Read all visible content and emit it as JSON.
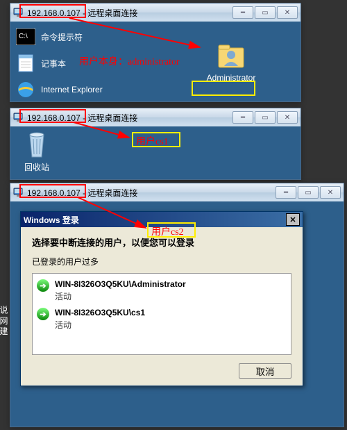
{
  "ip": "192.168.0.107",
  "title_suffix": " - 远程桌面连接",
  "window1": {
    "icons": {
      "cmd": "命令提示符",
      "notepad": "记事本",
      "ie": "Internet Explorer",
      "user": "Administrator"
    },
    "annotation": "用户本身：administrator"
  },
  "window2": {
    "icons": {
      "recycle": "回收站"
    },
    "annotation": "用户cs1"
  },
  "window3": {
    "annotation": "用户cs2",
    "dialog": {
      "title": "Windows 登录",
      "instruction": "选择要中断连接的用户，以便您可以登录",
      "subtext": "已登录的用户过多",
      "sessions": [
        {
          "name": "WIN-8I326O3Q5KU\\Administrator",
          "status": "活动"
        },
        {
          "name": "WIN-8I326O3Q5KU\\cs1",
          "status": "活动"
        }
      ],
      "cancel": "取消"
    }
  },
  "colors": {
    "annotation_red": "#ff0000",
    "annotation_yellow": "#ffee00",
    "desktop_bg": "#2d5f8b"
  }
}
